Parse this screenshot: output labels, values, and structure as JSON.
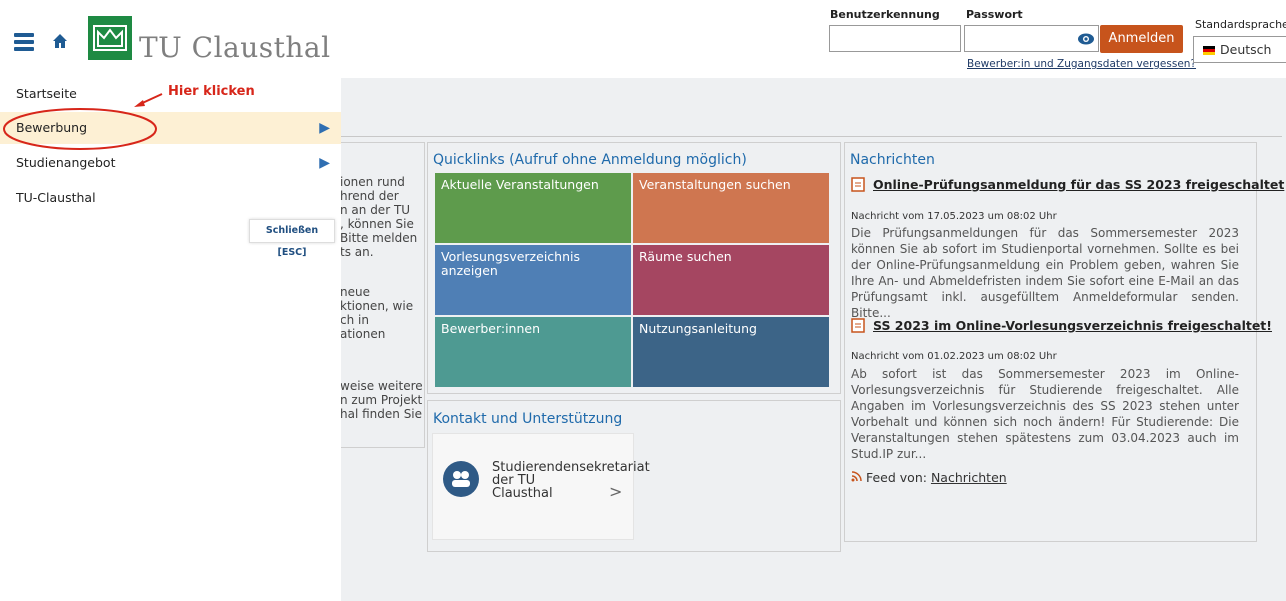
{
  "header": {
    "logo_text": "TU Clausthal",
    "username_label": "Benutzerkennung",
    "password_label": "Passwort",
    "login_button": "Anmelden",
    "forgot_link": "Bewerber:in und Zugangsdaten vergessen?",
    "language_label": "Standardsprache",
    "language_value": "Deutsch"
  },
  "sidemenu": {
    "items": [
      {
        "label": "Startseite"
      },
      {
        "label": "Bewerbung"
      },
      {
        "label": "Studienangebot"
      },
      {
        "label": "TU-Clausthal"
      }
    ],
    "close_button": "Schließen [ESC]",
    "hint": "Hier klicken"
  },
  "left_panel": {
    "lines_1": "ionen rund\nhrend der\nn an der TU\n, können Sie\nBitte melden\nts an.",
    "lines_2": "neue\nktionen, wie\nch in\nationen",
    "lines_3": "weise weitere\nn zum Projekt\nhal finden Sie"
  },
  "quicklinks": {
    "title": "Quicklinks (Aufruf ohne Anmeldung möglich)",
    "tiles": [
      {
        "label": "Aktuelle Veranstaltungen",
        "color": "#5e9b4c"
      },
      {
        "label": "Veranstaltungen suchen",
        "color": "#cf7650"
      },
      {
        "label": "Vorlesungsverzeichnis anzeigen",
        "color": "#4f7fb5"
      },
      {
        "label": "Räume suchen",
        "color": "#a54661"
      },
      {
        "label": "Bewerber:innen",
        "color": "#4e9a92"
      },
      {
        "label": "Nutzungsanleitung",
        "color": "#3c6487"
      }
    ]
  },
  "contact": {
    "title": "Kontakt und Unterstützung",
    "card_text": "Studierendensekretariat\nder TU\nClausthal"
  },
  "news": {
    "title": "Nachrichten",
    "items": [
      {
        "headline": "Online-Prüfungsanmeldung für das SS 2023 freigeschaltet",
        "date": "Nachricht vom 17.05.2023 um 08:02 Uhr",
        "body": "Die Prüfungsanmeldungen für das Sommersemester 2023 können Sie ab sofort im Studienportal vornehmen. Sollte es bei der Online-Prüfungsanmeldung ein Problem geben, wahren Sie Ihre An- und Abmeldefristen indem Sie sofort eine E-Mail an das Prüfungsamt inkl. ausgefülltem Anmeldeformular senden. Bitte..."
      },
      {
        "headline": "SS 2023 im Online-Vorlesungsverzeichnis freigeschaltet!",
        "date": "Nachricht vom 01.02.2023 um 08:02 Uhr",
        "body": "Ab sofort ist das Sommersemester 2023 im Online-Vorlesungsverzeichnis für Studierende freigeschaltet. Alle Angaben im Vorlesungsverzeichnis des SS 2023 stehen unter Vorbehalt und können sich noch ändern! Für Studierende: Die Veranstaltungen stehen spätestens zum 03.04.2023 auch im Stud.IP zur..."
      }
    ],
    "feed_label": "Feed von:",
    "feed_link": "Nachrichten"
  }
}
